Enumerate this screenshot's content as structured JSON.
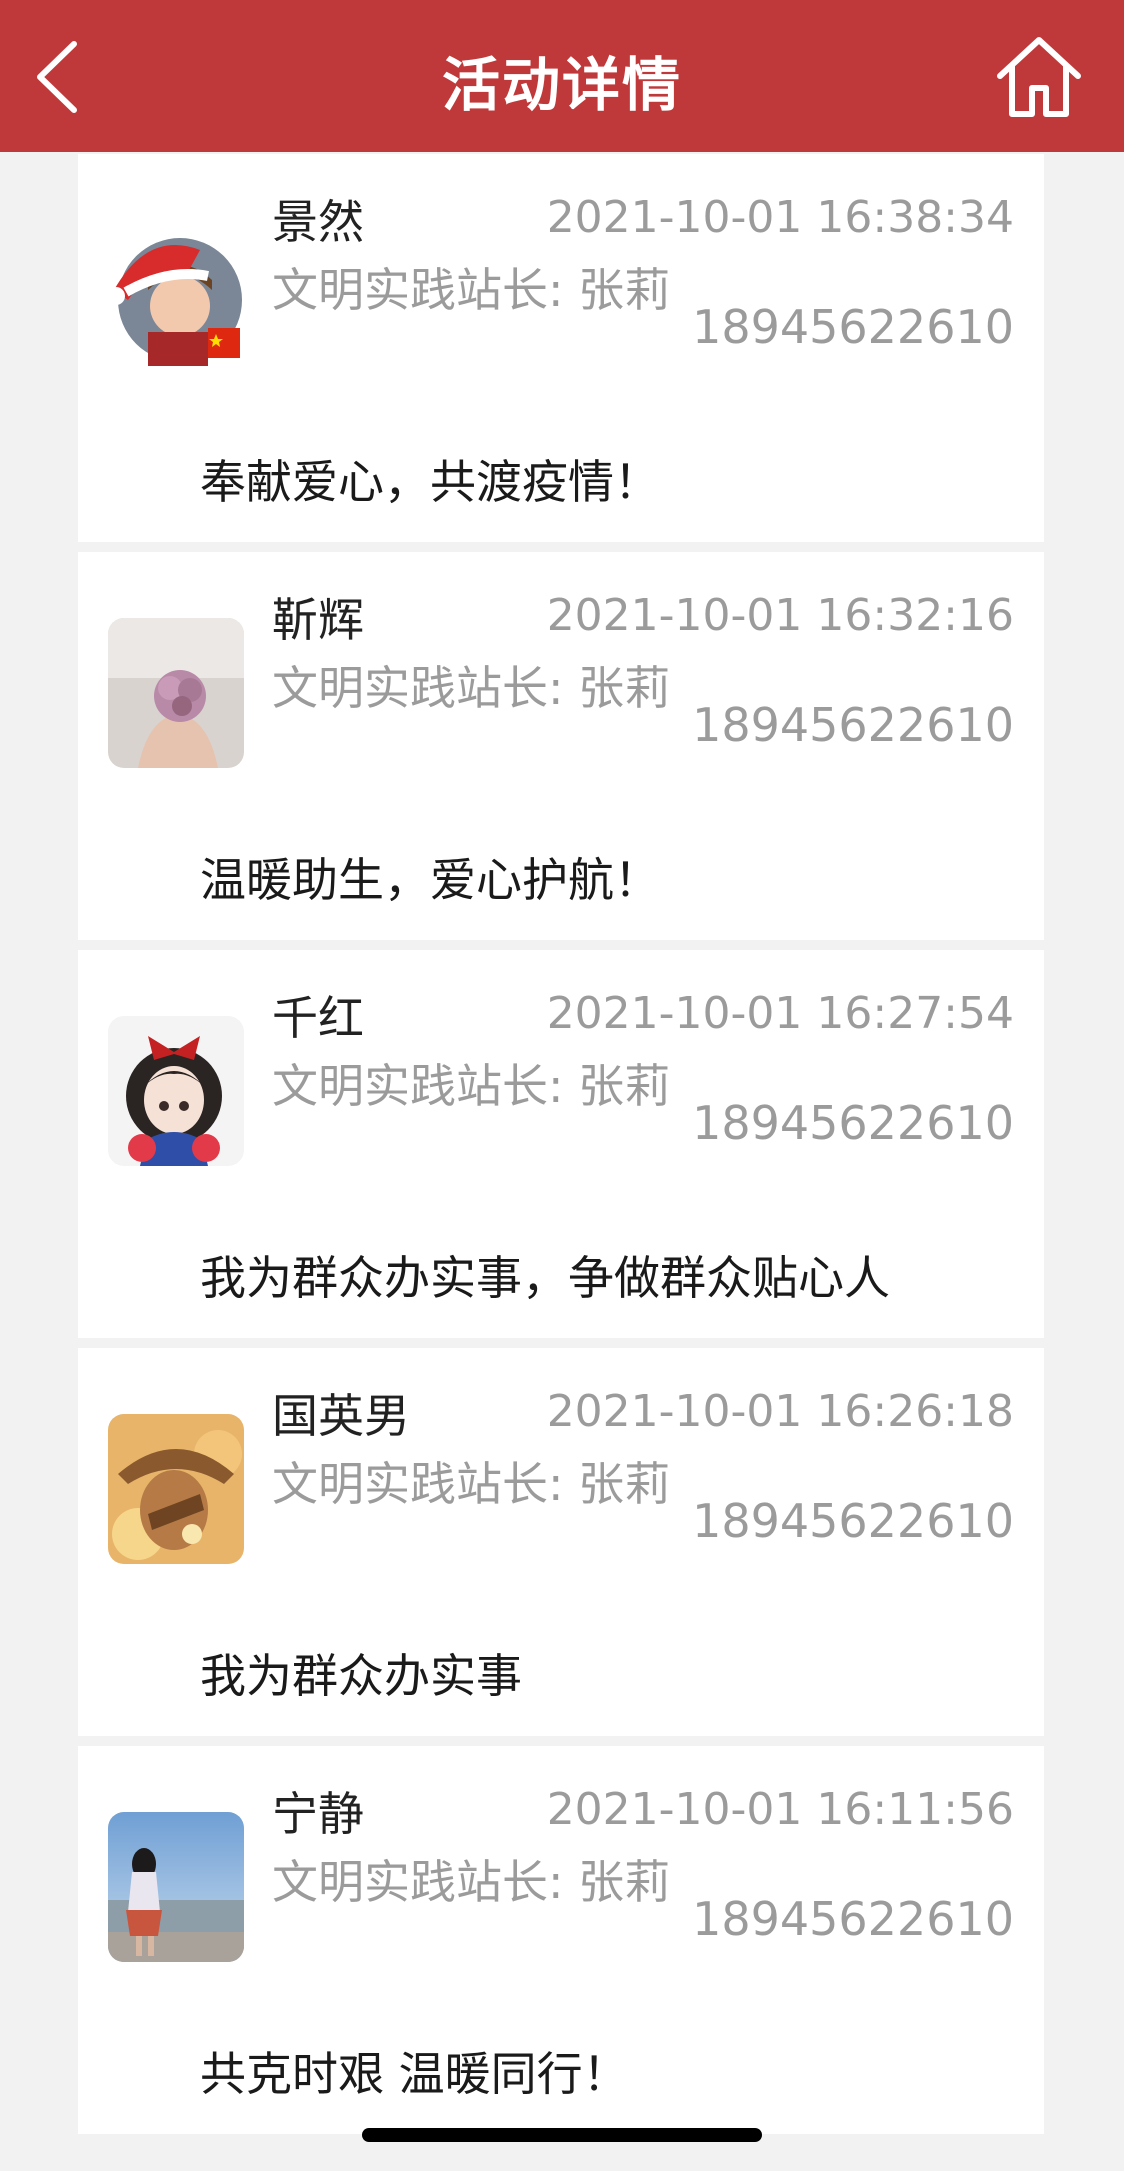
{
  "header": {
    "title": "活动详情",
    "back_icon": "chevron-left-icon",
    "home_icon": "home-icon",
    "background_color": "#c0393a"
  },
  "posts": [
    {
      "name": "景然",
      "time": "2021-10-01 16:38:34",
      "role": "文明实践站长: 张莉",
      "phone": "18945622610",
      "content": "奉献爱心，共渡疫情！"
    },
    {
      "name": "靳辉",
      "time": "2021-10-01 16:32:16",
      "role": "文明实践站长: 张莉",
      "phone": "18945622610",
      "content": "温暖助生，爱心护航！"
    },
    {
      "name": "千红",
      "time": "2021-10-01 16:27:54",
      "role": "文明实践站长: 张莉",
      "phone": "18945622610",
      "content": "我为群众办实事，争做群众贴心人"
    },
    {
      "name": "国英男",
      "time": "2021-10-01 16:26:18",
      "role": "文明实践站长: 张莉",
      "phone": "18945622610",
      "content": "我为群众办实事"
    },
    {
      "name": "宁静",
      "time": "2021-10-01 16:11:56",
      "role": "文明实践站长: 张莉",
      "phone": "18945622610",
      "content": "共克时艰 温暖同行！"
    }
  ]
}
